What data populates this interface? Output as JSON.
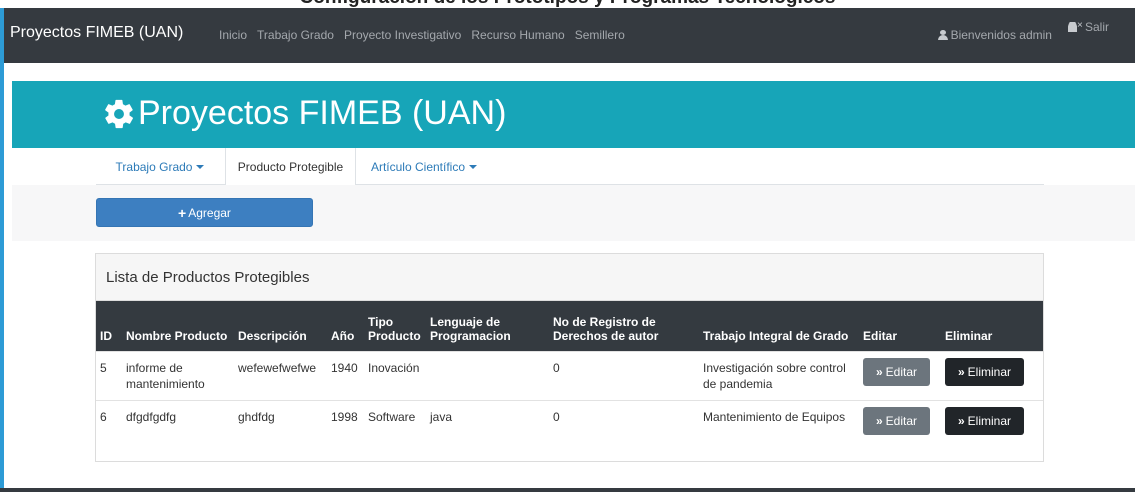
{
  "page_heading": "Configuración de los Prototipos y Programas Tecnológicos",
  "navbar": {
    "brand": "Proyectos FIMEB (UAN)",
    "links": [
      "Inicio",
      "Trabajo Grado",
      "Proyecto Investigativo",
      "Recurso Humano",
      "Semillero"
    ],
    "user_label": "Bienvenidos admin",
    "logout_label": "Salir"
  },
  "jumbotron": {
    "title": "Proyectos FIMEB (UAN)"
  },
  "tabs": [
    {
      "label": "Trabajo Grado",
      "dropdown": true,
      "active": false
    },
    {
      "label": "Producto Protegible",
      "dropdown": false,
      "active": true
    },
    {
      "label": "Artículo Científico",
      "dropdown": true,
      "active": false
    }
  ],
  "add_button": {
    "label": "Agregar"
  },
  "card": {
    "title": "Lista de Productos Protegibles"
  },
  "table": {
    "headers": [
      "ID",
      "Nombre Producto",
      "Descripción",
      "Año",
      "Tipo Producto",
      "Lenguaje de Programacion",
      "No de Registro de Derechos de autor",
      "Trabajo Integral de Grado",
      "Editar",
      "Eliminar"
    ],
    "rows": [
      {
        "id": "5",
        "nombre": "informe de mantenimiento",
        "descripcion": "wefewefwefwe",
        "anio": "1940",
        "tipo": "Inovación",
        "lenguaje": "",
        "registro": "0",
        "trabajo": "Investigación sobre control de pandemia"
      },
      {
        "id": "6",
        "nombre": "dfgdfgdfg",
        "descripcion": "ghdfdg",
        "anio": "1998",
        "tipo": "Software",
        "lenguaje": "java",
        "registro": "0",
        "trabajo": "Mantenimiento de Equipos"
      }
    ],
    "edit_label": "Editar",
    "delete_label": "Eliminar"
  },
  "colors": {
    "navbar_bg": "#353a40",
    "jumbotron_bg": "#17a5b8",
    "primary_button": "#3d7fc1",
    "edit_button": "#6c757d",
    "delete_button": "#212529"
  }
}
